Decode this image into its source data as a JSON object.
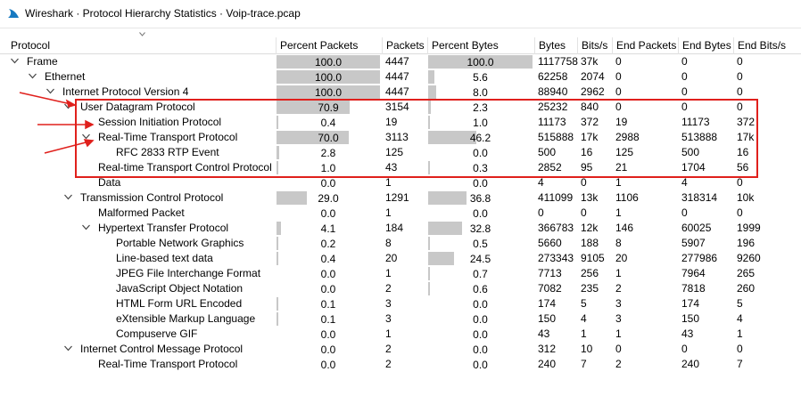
{
  "window": {
    "title": "Wireshark · Protocol Hierarchy Statistics · Voip-trace.pcap"
  },
  "columns": [
    "Protocol",
    "Percent Packets",
    "Packets",
    "Percent Bytes",
    "Bytes",
    "Bits/s",
    "End Packets",
    "End Bytes",
    "End Bits/s"
  ],
  "rows": [
    {
      "protocol": "Frame",
      "depth": 0,
      "expander": "down",
      "pct_packets": "100.0",
      "pct_packets_value": 100.0,
      "packets": "4447",
      "pct_bytes": "100.0",
      "pct_bytes_value": 100.0,
      "bytes": "1117758",
      "bits_s": "37k",
      "end_packets": "0",
      "end_bytes": "0",
      "end_bits_s": "0"
    },
    {
      "protocol": "Ethernet",
      "depth": 1,
      "expander": "down",
      "pct_packets": "100.0",
      "pct_packets_value": 100.0,
      "packets": "4447",
      "pct_bytes": "5.6",
      "pct_bytes_value": 5.6,
      "bytes": "62258",
      "bits_s": "2074",
      "end_packets": "0",
      "end_bytes": "0",
      "end_bits_s": "0"
    },
    {
      "protocol": "Internet Protocol Version 4",
      "depth": 2,
      "expander": "down",
      "pct_packets": "100.0",
      "pct_packets_value": 100.0,
      "packets": "4447",
      "pct_bytes": "8.0",
      "pct_bytes_value": 8.0,
      "bytes": "88940",
      "bits_s": "2962",
      "end_packets": "0",
      "end_bytes": "0",
      "end_bits_s": "0"
    },
    {
      "protocol": "User Datagram Protocol",
      "depth": 3,
      "expander": "down",
      "pct_packets": "70.9",
      "pct_packets_value": 70.9,
      "packets": "3154",
      "pct_bytes": "2.3",
      "pct_bytes_value": 2.3,
      "bytes": "25232",
      "bits_s": "840",
      "end_packets": "0",
      "end_bytes": "0",
      "end_bits_s": "0"
    },
    {
      "protocol": "Session Initiation Protocol",
      "depth": 4,
      "expander": "none",
      "pct_packets": "0.4",
      "pct_packets_value": 0.4,
      "packets": "19",
      "pct_bytes": "1.0",
      "pct_bytes_value": 1.0,
      "bytes": "11173",
      "bits_s": "372",
      "end_packets": "19",
      "end_bytes": "11173",
      "end_bits_s": "372"
    },
    {
      "protocol": "Real-Time Transport Protocol",
      "depth": 4,
      "expander": "down",
      "pct_packets": "70.0",
      "pct_packets_value": 70.0,
      "packets": "3113",
      "pct_bytes": "46.2",
      "pct_bytes_value": 46.2,
      "bytes": "515888",
      "bits_s": "17k",
      "end_packets": "2988",
      "end_bytes": "513888",
      "end_bits_s": "17k"
    },
    {
      "protocol": "RFC 2833 RTP Event",
      "depth": 5,
      "expander": "none",
      "pct_packets": "2.8",
      "pct_packets_value": 2.8,
      "packets": "125",
      "pct_bytes": "0.0",
      "pct_bytes_value": 0.0,
      "bytes": "500",
      "bits_s": "16",
      "end_packets": "125",
      "end_bytes": "500",
      "end_bits_s": "16"
    },
    {
      "protocol": "Real-time Transport Control Protocol",
      "depth": 4,
      "expander": "none",
      "pct_packets": "1.0",
      "pct_packets_value": 1.0,
      "packets": "43",
      "pct_bytes": "0.3",
      "pct_bytes_value": 0.3,
      "bytes": "2852",
      "bits_s": "95",
      "end_packets": "21",
      "end_bytes": "1704",
      "end_bits_s": "56"
    },
    {
      "protocol": "Data",
      "depth": 4,
      "expander": "none",
      "pct_packets": "0.0",
      "pct_packets_value": 0.0,
      "packets": "1",
      "pct_bytes": "0.0",
      "pct_bytes_value": 0.0,
      "bytes": "4",
      "bits_s": "0",
      "end_packets": "1",
      "end_bytes": "4",
      "end_bits_s": "0"
    },
    {
      "protocol": "Transmission Control Protocol",
      "depth": 3,
      "expander": "down",
      "pct_packets": "29.0",
      "pct_packets_value": 29.0,
      "packets": "1291",
      "pct_bytes": "36.8",
      "pct_bytes_value": 36.8,
      "bytes": "411099",
      "bits_s": "13k",
      "end_packets": "1106",
      "end_bytes": "318314",
      "end_bits_s": "10k"
    },
    {
      "protocol": "Malformed Packet",
      "depth": 4,
      "expander": "none",
      "pct_packets": "0.0",
      "pct_packets_value": 0.0,
      "packets": "1",
      "pct_bytes": "0.0",
      "pct_bytes_value": 0.0,
      "bytes": "0",
      "bits_s": "0",
      "end_packets": "1",
      "end_bytes": "0",
      "end_bits_s": "0"
    },
    {
      "protocol": "Hypertext Transfer Protocol",
      "depth": 4,
      "expander": "down",
      "pct_packets": "4.1",
      "pct_packets_value": 4.1,
      "packets": "184",
      "pct_bytes": "32.8",
      "pct_bytes_value": 32.8,
      "bytes": "366783",
      "bits_s": "12k",
      "end_packets": "146",
      "end_bytes": "60025",
      "end_bits_s": "1999"
    },
    {
      "protocol": "Portable Network Graphics",
      "depth": 5,
      "expander": "none",
      "pct_packets": "0.2",
      "pct_packets_value": 0.2,
      "packets": "8",
      "pct_bytes": "0.5",
      "pct_bytes_value": 0.5,
      "bytes": "5660",
      "bits_s": "188",
      "end_packets": "8",
      "end_bytes": "5907",
      "end_bits_s": "196"
    },
    {
      "protocol": "Line-based text data",
      "depth": 5,
      "expander": "none",
      "pct_packets": "0.4",
      "pct_packets_value": 0.4,
      "packets": "20",
      "pct_bytes": "24.5",
      "pct_bytes_value": 24.5,
      "bytes": "273343",
      "bits_s": "9105",
      "end_packets": "20",
      "end_bytes": "277986",
      "end_bits_s": "9260"
    },
    {
      "protocol": "JPEG File Interchange Format",
      "depth": 5,
      "expander": "none",
      "pct_packets": "0.0",
      "pct_packets_value": 0.0,
      "packets": "1",
      "pct_bytes": "0.7",
      "pct_bytes_value": 0.7,
      "bytes": "7713",
      "bits_s": "256",
      "end_packets": "1",
      "end_bytes": "7964",
      "end_bits_s": "265"
    },
    {
      "protocol": "JavaScript Object Notation",
      "depth": 5,
      "expander": "none",
      "pct_packets": "0.0",
      "pct_packets_value": 0.0,
      "packets": "2",
      "pct_bytes": "0.6",
      "pct_bytes_value": 0.6,
      "bytes": "7082",
      "bits_s": "235",
      "end_packets": "2",
      "end_bytes": "7818",
      "end_bits_s": "260"
    },
    {
      "protocol": "HTML Form URL Encoded",
      "depth": 5,
      "expander": "none",
      "pct_packets": "0.1",
      "pct_packets_value": 0.1,
      "packets": "3",
      "pct_bytes": "0.0",
      "pct_bytes_value": 0.0,
      "bytes": "174",
      "bits_s": "5",
      "end_packets": "3",
      "end_bytes": "174",
      "end_bits_s": "5"
    },
    {
      "protocol": "eXtensible Markup Language",
      "depth": 5,
      "expander": "none",
      "pct_packets": "0.1",
      "pct_packets_value": 0.1,
      "packets": "3",
      "pct_bytes": "0.0",
      "pct_bytes_value": 0.0,
      "bytes": "150",
      "bits_s": "4",
      "end_packets": "3",
      "end_bytes": "150",
      "end_bits_s": "4"
    },
    {
      "protocol": "Compuserve GIF",
      "depth": 5,
      "expander": "none",
      "pct_packets": "0.0",
      "pct_packets_value": 0.0,
      "packets": "1",
      "pct_bytes": "0.0",
      "pct_bytes_value": 0.0,
      "bytes": "43",
      "bits_s": "1",
      "end_packets": "1",
      "end_bytes": "43",
      "end_bits_s": "1"
    },
    {
      "protocol": "Internet Control Message Protocol",
      "depth": 3,
      "expander": "down",
      "pct_packets": "0.0",
      "pct_packets_value": 0.0,
      "packets": "2",
      "pct_bytes": "0.0",
      "pct_bytes_value": 0.0,
      "bytes": "312",
      "bits_s": "10",
      "end_packets": "0",
      "end_bytes": "0",
      "end_bits_s": "0"
    },
    {
      "protocol": "Real-Time Transport Protocol",
      "depth": 4,
      "expander": "none",
      "pct_packets": "0.0",
      "pct_packets_value": 0.0,
      "packets": "2",
      "pct_bytes": "0.0",
      "pct_bytes_value": 0.0,
      "bytes": "240",
      "bits_s": "7",
      "end_packets": "2",
      "end_bytes": "240",
      "end_bits_s": "7"
    }
  ],
  "annotation": {
    "color": "#e0201c"
  },
  "colors": {
    "bar": "#c8c8c8",
    "grid": "#e3e3e3"
  }
}
